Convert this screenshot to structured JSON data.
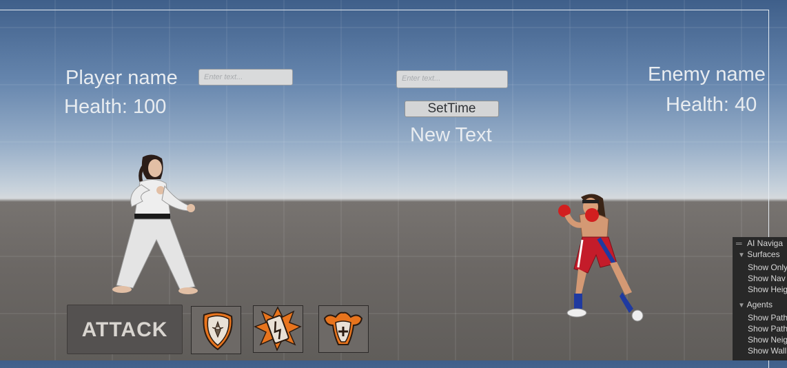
{
  "hud": {
    "player_name": "Player name",
    "player_health": "Health: 100",
    "enemy_name": "Enemy name",
    "enemy_health": "Health: 40",
    "new_text": "New Text"
  },
  "inputs": {
    "player_placeholder": "Enter text...",
    "time_placeholder": "Enter text..."
  },
  "buttons": {
    "set_time": "SetTime",
    "attack": "ATTACK"
  },
  "skills": [
    "shield-icon",
    "energy-battery-icon",
    "strength-heal-icon"
  ],
  "colors": {
    "skill_orange": "#e8741d",
    "ui_text": "#e8ecf0",
    "panel_bg": "#282828"
  },
  "nav_panel": {
    "title": "AI Naviga",
    "surfaces_header": "Surfaces",
    "surfaces_items": [
      "Show Only",
      "Show Nav",
      "Show Heig"
    ],
    "agents_header": "Agents",
    "agents_items": [
      "Show Path",
      "Show Path",
      "Show Neig",
      "Show Wall"
    ]
  }
}
